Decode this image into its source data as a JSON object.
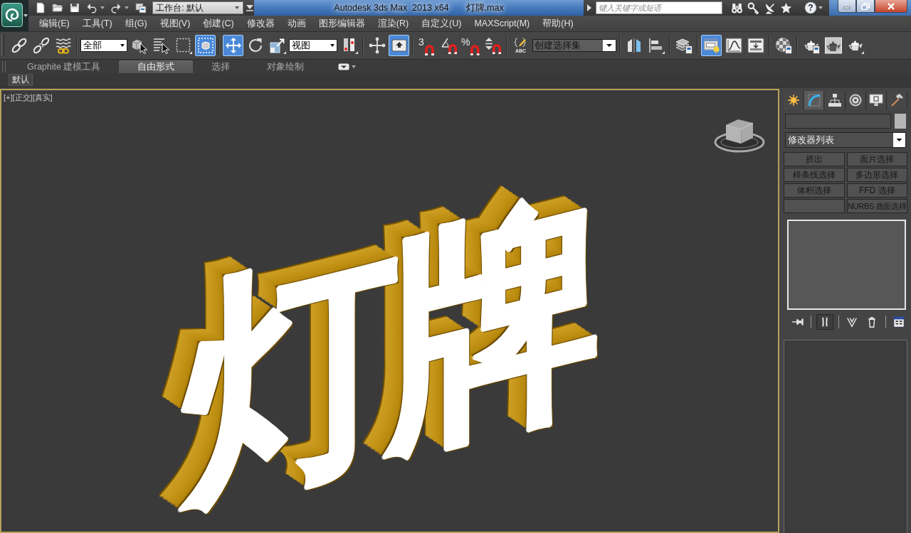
{
  "window": {
    "title": "Autodesk 3ds Max  2013 x64",
    "file": "灯牌.max",
    "workspace": "工作台: 默认"
  },
  "search": {
    "placeholder": "键入关键字或短语",
    "help_glyph": "?"
  },
  "menu": [
    "编辑(E)",
    "工具(T)",
    "组(G)",
    "视图(V)",
    "创建(C)",
    "修改器",
    "动画",
    "图形编辑器",
    "渲染(R)",
    "自定义(U)",
    "MAXScript(M)",
    "帮助(H)"
  ],
  "toolbar": {
    "groups": [
      [
        {
          "kind": "button",
          "selected": false
        },
        {
          "kind": "button",
          "selected": false
        },
        {
          "kind": "button",
          "selected": false
        }
      ],
      [
        {
          "kind": "dropdown",
          "value": "全部"
        },
        {
          "kind": "button",
          "selected": false
        },
        {
          "kind": "button",
          "selected": false
        },
        {
          "kind": "button",
          "selected": false
        },
        {
          "kind": "button",
          "selected": true
        }
      ],
      [
        {
          "kind": "button",
          "selected": true
        },
        {
          "kind": "button",
          "selected": false
        },
        {
          "kind": "button",
          "selected": false
        },
        {
          "kind": "dropdown",
          "value": "视图"
        },
        {
          "kind": "button",
          "selected": false
        }
      ],
      [
        {
          "kind": "button",
          "selected": false
        },
        {
          "kind": "button",
          "selected": true
        }
      ],
      [
        {
          "kind": "button",
          "selected": false,
          "glyph": "3"
        },
        {
          "kind": "button",
          "selected": false
        },
        {
          "kind": "button",
          "selected": false,
          "glyph": "%"
        },
        {
          "kind": "button",
          "selected": false
        }
      ],
      [
        {
          "kind": "button",
          "selected": false,
          "glyph": "ABC"
        },
        {
          "kind": "combo",
          "placeholder": "创建选择集"
        }
      ],
      [
        {
          "kind": "button",
          "selected": false
        },
        {
          "kind": "button",
          "selected": false
        }
      ],
      [
        {
          "kind": "button",
          "selected": false
        }
      ],
      [
        {
          "kind": "button",
          "selected": true
        },
        {
          "kind": "button",
          "selected": false
        },
        {
          "kind": "button",
          "selected": false
        }
      ],
      [
        {
          "kind": "button",
          "selected": false
        }
      ],
      [
        {
          "kind": "button",
          "selected": false
        },
        {
          "kind": "button",
          "selected": false
        },
        {
          "kind": "button",
          "selected": false
        }
      ]
    ]
  },
  "ribbon": {
    "tabs": [
      {
        "label": "Graphite 建模工具",
        "selected": false
      },
      {
        "label": "自由形式",
        "selected": true
      },
      {
        "label": "选择",
        "selected": false
      },
      {
        "label": "对象绘制",
        "selected": false
      }
    ],
    "panel": "默认"
  },
  "viewport": {
    "active": true,
    "labels": [
      "[+]",
      "[正交]",
      "[真实]"
    ],
    "scene_text": "灯牌"
  },
  "command_panel": {
    "tabs": [
      {
        "selected": false
      },
      {
        "selected": true
      },
      {
        "selected": false
      },
      {
        "selected": false
      },
      {
        "selected": false
      },
      {
        "selected": false
      }
    ],
    "modifier_list": "修改器列表",
    "modifier_sets": [
      {
        "kind": "set",
        "label": "挤出"
      },
      {
        "kind": "set",
        "label": "面片选择"
      },
      {
        "kind": "set",
        "label": "样条线选择"
      },
      {
        "kind": "set",
        "label": "多边形选择"
      },
      {
        "kind": "set",
        "label": "体积选择"
      },
      {
        "kind": "set",
        "label": "FFD 选择"
      },
      {
        "kind": "empty"
      },
      {
        "kind": "set",
        "label": "NURBS 曲面选择"
      }
    ],
    "stack_tools": [
      {
        "selected": false
      },
      {
        "selected": true
      },
      {
        "selected": false
      },
      {
        "selected": false
      },
      {
        "selected": false
      }
    ]
  }
}
